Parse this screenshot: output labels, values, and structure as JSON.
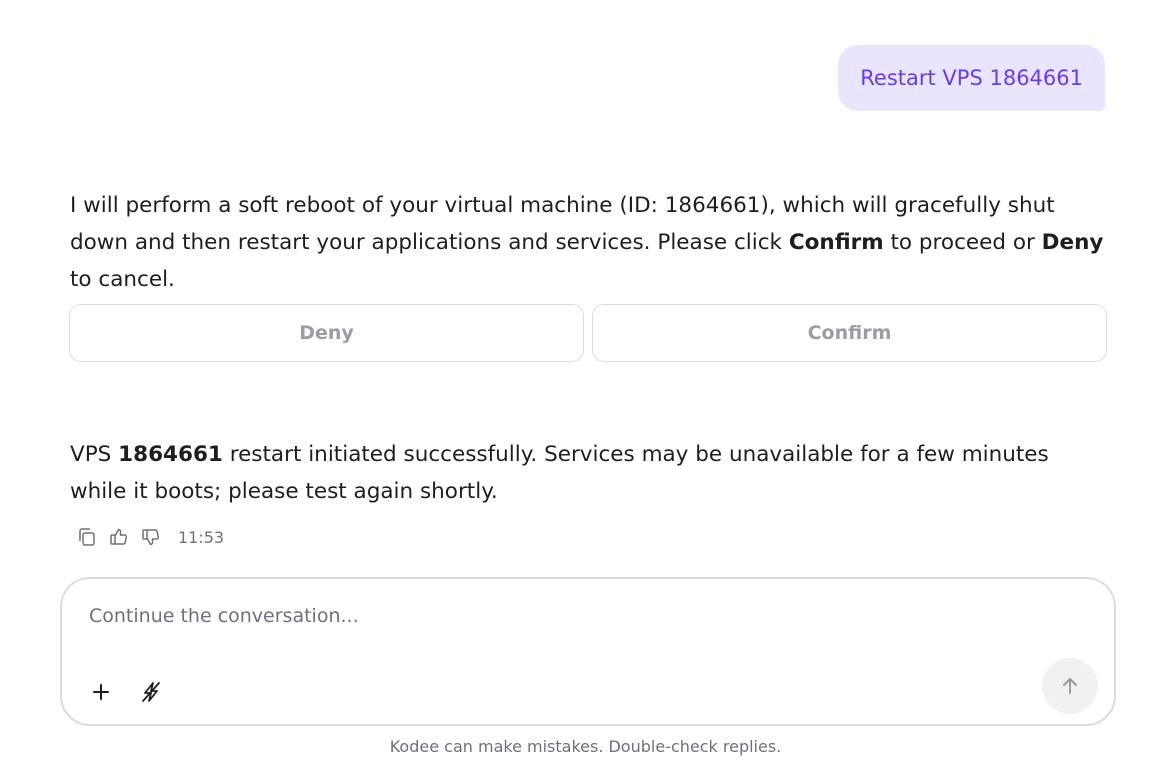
{
  "user_message": "Restart VPS 1864661",
  "assistant_message_1": {
    "part1": "I will perform a soft reboot of your virtual machine (ID: 1864661), which will gracefully shut down and then restart your applications and services. Please click ",
    "confirm_word": "Confirm",
    "part2": " to proceed or ",
    "deny_word": "Deny",
    "part3": " to cancel."
  },
  "actions": {
    "deny_label": "Deny",
    "confirm_label": "Confirm"
  },
  "assistant_message_2": {
    "prefix": "VPS ",
    "vps_id": "1864661",
    "rest": " restart initiated successfully. Services may be unavailable for a few minutes while it boots; please test again shortly."
  },
  "feedback": {
    "icons": [
      "copy-icon",
      "thumbs-up-icon",
      "thumbs-down-icon"
    ],
    "timestamp": "11:53"
  },
  "composer": {
    "placeholder": "Continue the conversation...",
    "icons": [
      "plus-icon",
      "bolt-icon",
      "arrow-up-icon"
    ]
  },
  "disclaimer": "Kodee can make mistakes. Double-check replies.",
  "colors": {
    "accent": "#673de6",
    "user_bubble_bg": "#ebe4ff",
    "muted_text": "#6d7081",
    "border": "#dadce0"
  }
}
